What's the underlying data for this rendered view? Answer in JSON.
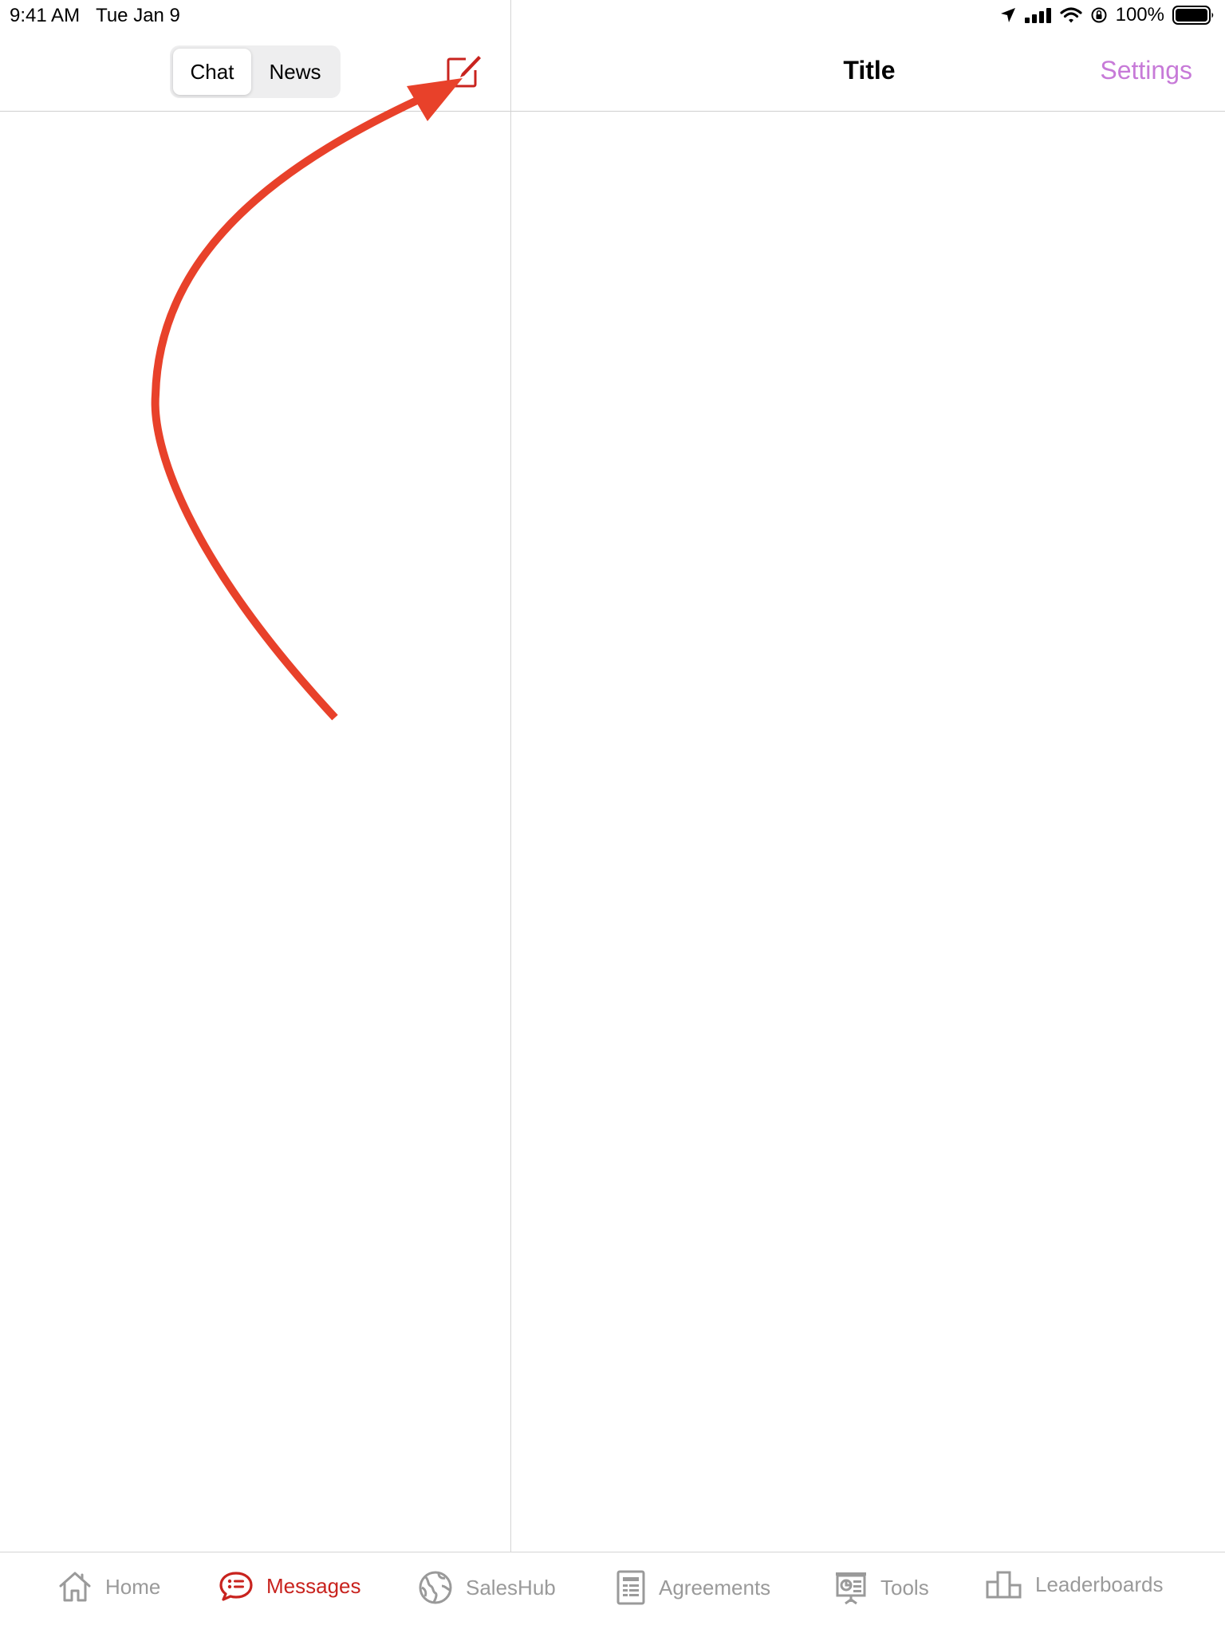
{
  "status_bar": {
    "time": "9:41 AM",
    "date": "Tue Jan 9",
    "battery": "100%"
  },
  "sidebar": {
    "segments": [
      {
        "label": "Chat",
        "selected": true
      },
      {
        "label": "News",
        "selected": false
      }
    ],
    "compose_icon": "compose-icon"
  },
  "detail": {
    "title": "Title",
    "settings_label": "Settings"
  },
  "tabs": [
    {
      "label": "Home",
      "icon": "home-icon",
      "active": false
    },
    {
      "label": "Messages",
      "icon": "chat-bubble-icon",
      "active": true
    },
    {
      "label": "SalesHub",
      "icon": "globe-icon",
      "active": false
    },
    {
      "label": "Agreements",
      "icon": "document-icon",
      "active": false
    },
    {
      "label": "Tools",
      "icon": "presentation-icon",
      "active": false
    },
    {
      "label": "Leaderboards",
      "icon": "podium-icon",
      "active": false
    }
  ],
  "colors": {
    "accent": "#c8231e",
    "settings": "#c77ad8",
    "inactive": "#9a9a9a",
    "annotation": "#e8412a"
  }
}
